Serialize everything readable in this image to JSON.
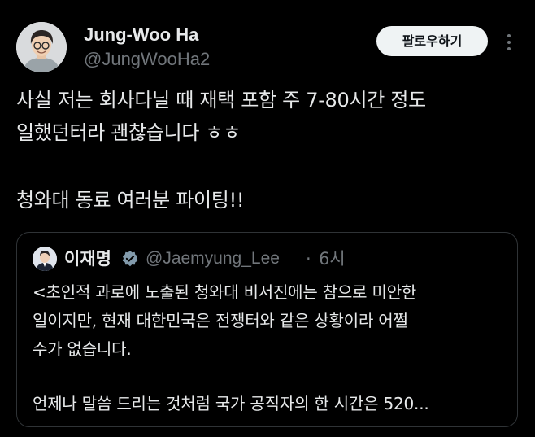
{
  "author": {
    "name": "Jung-Woo Ha",
    "handle": "@JungWooHa2"
  },
  "follow_button": {
    "label": "팔로우하기"
  },
  "more_button": {
    "icon": "more-vertical-icon"
  },
  "tweet": {
    "lines": [
      "사실 저는 회사다닐 때 재택 포함 주 7-80시간 정도",
      "일했던터라 괜찮습니다 ㅎㅎ",
      "청와대 동료 여러분 파이팅!!"
    ]
  },
  "quote": {
    "name": "이재명",
    "verified_icon": "verified-badge-icon",
    "handle": "@Jaemyung_Lee",
    "separator": "·",
    "time": "6시",
    "lines": [
      "<초인적 과로에 노출된 청와대 비서진에는 참으로 미안한",
      "일이지만, 현재 대한민국은 전쟁터와 같은 상황이라 어쩔",
      "수가 없습니다.",
      "언제나 말씀 드리는 것처럼 국가 공직자의 한 시간은 520..."
    ]
  },
  "colors": {
    "background": "#000000",
    "text_primary": "#e7e9ea",
    "text_secondary": "#71767b",
    "border": "#2f3336",
    "follow_bg": "#eff3f4",
    "verified": "#829aab"
  }
}
